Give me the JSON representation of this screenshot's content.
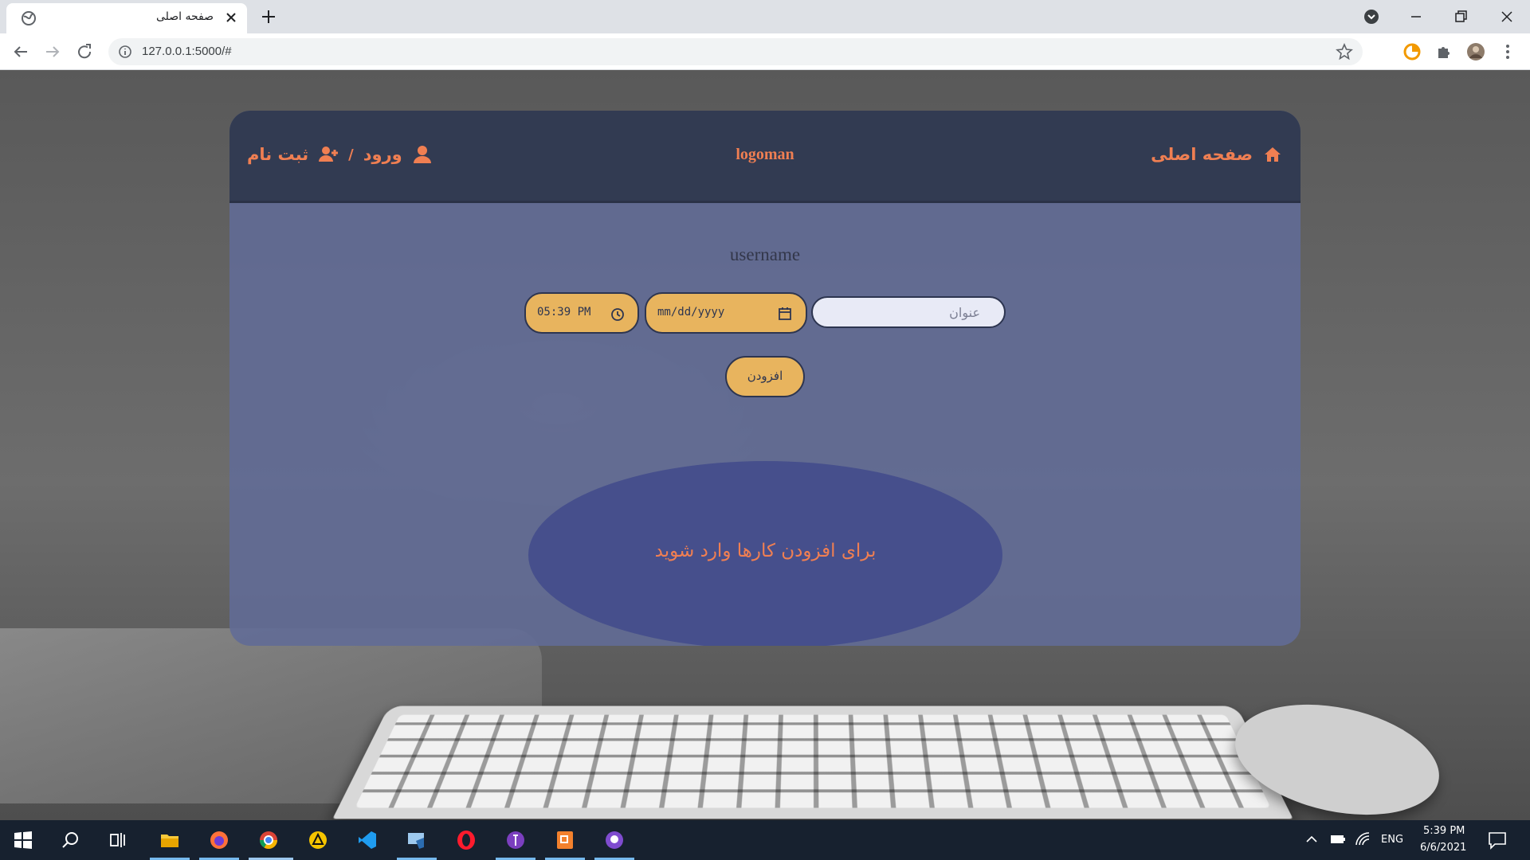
{
  "browser": {
    "tab_title": "صفحه اصلی",
    "url": "127.0.0.1:5000/#"
  },
  "nav": {
    "home_label": "صفحه اصلی",
    "logo": "logoman",
    "login_label": "ورود",
    "separator": "/",
    "register_label": "ثبت نام"
  },
  "main": {
    "username": "username",
    "time_value": "05:39 PM",
    "date_placeholder": "mm/dd/yyyy",
    "title_placeholder": "عنوان",
    "add_button": "افزودن",
    "login_message": "برای افزودن کارها وارد شوید"
  },
  "taskbar": {
    "language": "ENG",
    "time": "5:39 PM",
    "date": "6/6/2021"
  },
  "colors": {
    "accent": "#f07f52",
    "nav_bg": "#323b52",
    "input_bg": "#e8b45e",
    "oval_bg": "#464f8c"
  }
}
